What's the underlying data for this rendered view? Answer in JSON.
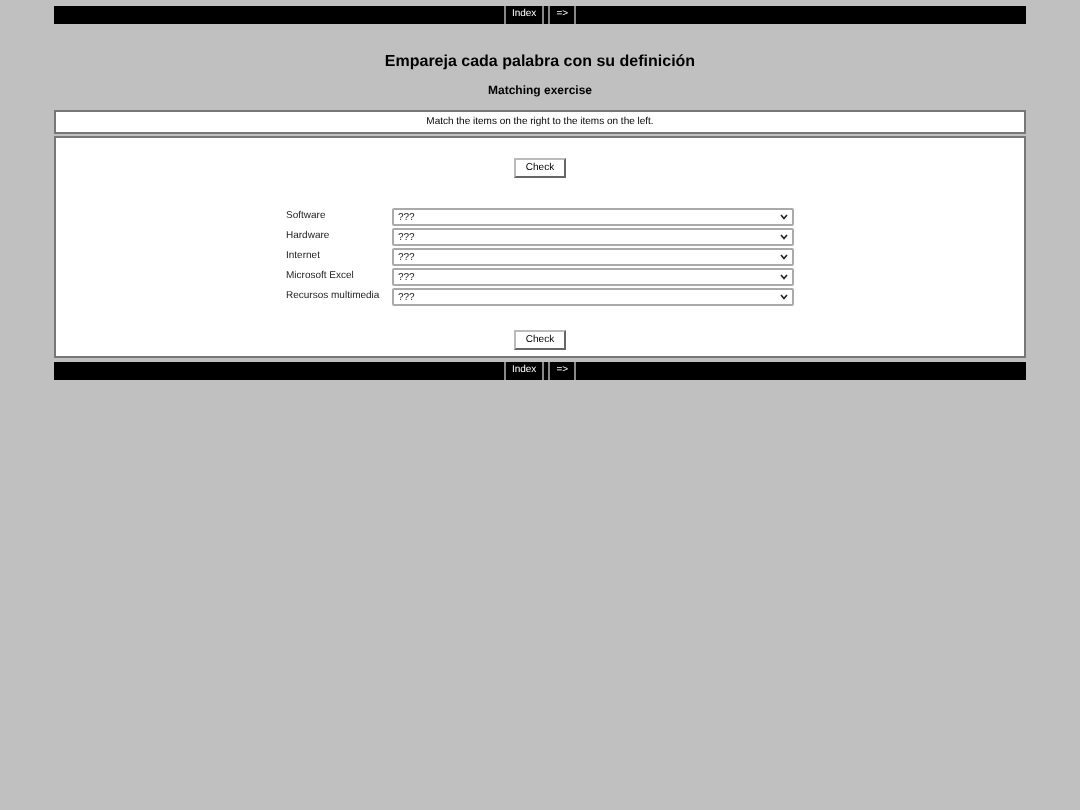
{
  "nav_top": {
    "buttons": [
      "Index",
      "=>"
    ]
  },
  "title": "Empareja cada palabra con su definición",
  "subtitle": "Matching exercise",
  "instructions": "Match the items on the right to the items on the left.",
  "check_top": "Check",
  "items": [
    {
      "term": "Software",
      "value": "???"
    },
    {
      "term": "Hardware",
      "value": "???"
    },
    {
      "term": "Internet",
      "value": "???"
    },
    {
      "term": "Microsoft Excel",
      "value": "???"
    },
    {
      "term": "Recursos multimedia",
      "value": "???"
    }
  ],
  "check_bottom": "Check",
  "nav_bottom": {
    "buttons": [
      "Index",
      "=>"
    ]
  }
}
